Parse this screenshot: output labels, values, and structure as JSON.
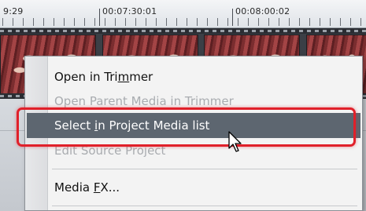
{
  "ruler": {
    "timecodes": [
      "9:29",
      "00:07:30:01",
      "00:08:00:02"
    ]
  },
  "track": {
    "thumbnail_count": 4
  },
  "context_menu": {
    "items": [
      {
        "pre": "Open in Tri",
        "ul": "m",
        "post": "mer",
        "state": "enabled"
      },
      {
        "pre": "Open Parent Media in Trimmer",
        "ul": "",
        "post": "",
        "state": "disabled"
      },
      {
        "pre": "Select ",
        "ul": "i",
        "post": "n Project Media list",
        "state": "selected"
      },
      {
        "pre": "Edit Source Project",
        "ul": "",
        "post": "",
        "state": "disabled"
      },
      {
        "pre": "Media ",
        "ul": "F",
        "post": "X...",
        "state": "enabled"
      }
    ]
  },
  "colors": {
    "selection": "#5d6670",
    "highlight_outline": "#e0202a"
  },
  "icons": {
    "cursor": "mouse-pointer-icon"
  }
}
